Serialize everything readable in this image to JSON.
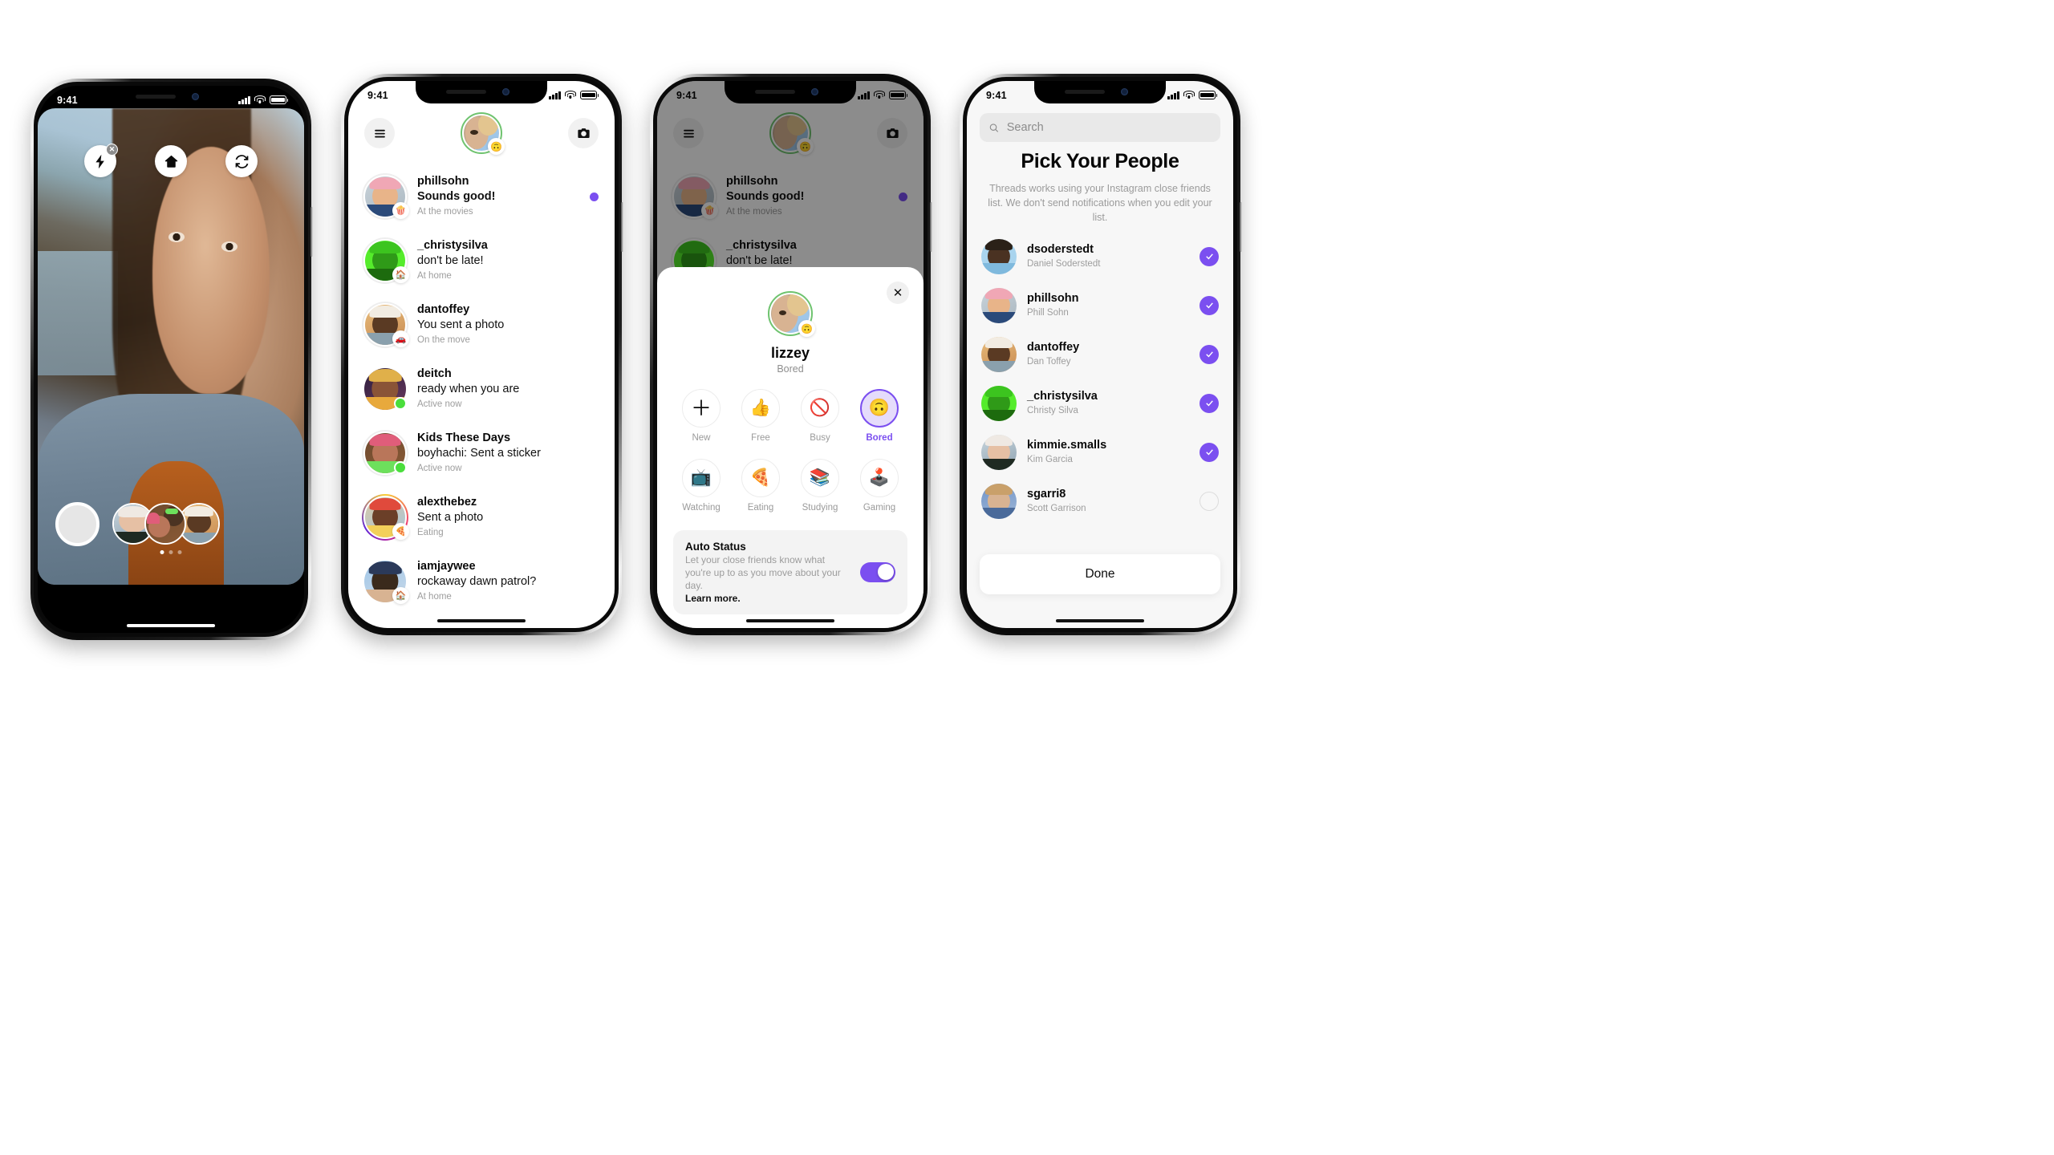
{
  "status_bar": {
    "time": "9:41"
  },
  "phone1": {
    "name": "camera-screen",
    "controls": [
      {
        "name": "flash-off-button",
        "icon": "flash-off-icon"
      },
      {
        "name": "home-button",
        "icon": "home-icon"
      },
      {
        "name": "flip-camera-button",
        "icon": "camera-flip-icon"
      }
    ],
    "shutter": "shutter-button",
    "tray": [
      {
        "name": "kimmie"
      },
      {
        "name": "kids-these-days"
      },
      {
        "name": "dantoffey"
      }
    ],
    "page_dots": 3,
    "active_dot": 0
  },
  "phone2": {
    "header": {
      "menu_icon": "hamburger-menu-icon",
      "camera_icon": "camera-icon",
      "me_status_emoji": "🙃"
    },
    "threads": [
      {
        "name": "phillsohn",
        "message": "Sounds good!",
        "bold": true,
        "sub": "At the movies",
        "badge": "🍿",
        "unread": true,
        "ring": "plain"
      },
      {
        "name": "_christysilva",
        "message": "don't be late!",
        "bold": false,
        "sub": "At home",
        "badge": "🏠",
        "unread": false,
        "ring": "plain"
      },
      {
        "name": "dantoffey",
        "message": "You sent a photo",
        "bold": false,
        "sub": "On the move",
        "badge": "🚗",
        "unread": false,
        "ring": "plain"
      },
      {
        "name": "deitch",
        "message": "ready when you are",
        "bold": false,
        "sub": "Active now",
        "badge": "",
        "unread": false,
        "ring": "none",
        "online": true
      },
      {
        "name": "Kids These Days",
        "message": "boyhachi: Sent a sticker",
        "bold": false,
        "sub": "Active now",
        "badge": "",
        "unread": false,
        "ring": "plain",
        "online": true
      },
      {
        "name": "alexthebez",
        "message": "Sent a photo",
        "bold": false,
        "sub": "Eating",
        "badge": "🍕",
        "unread": false,
        "ring": "ig"
      },
      {
        "name": "iamjaywee",
        "message": "rockaway dawn patrol?",
        "bold": false,
        "sub": "At home",
        "badge": "🏠",
        "unread": false,
        "ring": "none"
      }
    ]
  },
  "phone3": {
    "sheet": {
      "close_icon": "close-icon",
      "username": "lizzey",
      "current_status": "Bored",
      "statuses_row1": [
        {
          "label": "New",
          "emoji": "＋",
          "selected": false,
          "icon": "plus-icon"
        },
        {
          "label": "Free",
          "emoji": "👍",
          "selected": false,
          "icon": "thumbs-up-icon"
        },
        {
          "label": "Busy",
          "emoji": "🚫",
          "selected": false,
          "icon": "prohibited-icon"
        },
        {
          "label": "Bored",
          "emoji": "🙃",
          "selected": true,
          "icon": "upside-down-face-icon"
        }
      ],
      "statuses_row2": [
        {
          "label": "Watching",
          "emoji": "📺",
          "selected": false,
          "icon": "television-icon"
        },
        {
          "label": "Eating",
          "emoji": "🍕",
          "selected": false,
          "icon": "pizza-icon"
        },
        {
          "label": "Studying",
          "emoji": "📚",
          "selected": false,
          "icon": "books-icon"
        },
        {
          "label": "Gaming",
          "emoji": "🕹️",
          "selected": false,
          "icon": "joystick-icon"
        }
      ],
      "auto_status": {
        "title": "Auto Status",
        "description": "Let your close friends know what you're up to as you move about your day.",
        "link": "Learn more.",
        "toggle_on": true
      }
    }
  },
  "phone4": {
    "search_placeholder": "Search",
    "search_value": "",
    "title": "Pick Your People",
    "description": "Threads works using your Instagram close friends list. We don't send notifications when you edit your list.",
    "people": [
      {
        "username": "dsoderstedt",
        "realname": "Daniel Soderstedt",
        "selected": true
      },
      {
        "username": "phillsohn",
        "realname": "Phill Sohn",
        "selected": true
      },
      {
        "username": "dantoffey",
        "realname": "Dan Toffey",
        "selected": true
      },
      {
        "username": "_christysilva",
        "realname": "Christy Silva",
        "selected": true
      },
      {
        "username": "kimmie.smalls",
        "realname": "Kim Garcia",
        "selected": true
      },
      {
        "username": "sgarri8",
        "realname": "Scott Garrison",
        "selected": false
      }
    ],
    "done_label": "Done"
  },
  "colors": {
    "accent_purple": "#7B4FF0",
    "selected_chip_bg": "#E5DCFB",
    "online_green": "#4ADE3C",
    "story_ring_green": "#6FC36F",
    "page_bg": "#FFFFFF"
  }
}
